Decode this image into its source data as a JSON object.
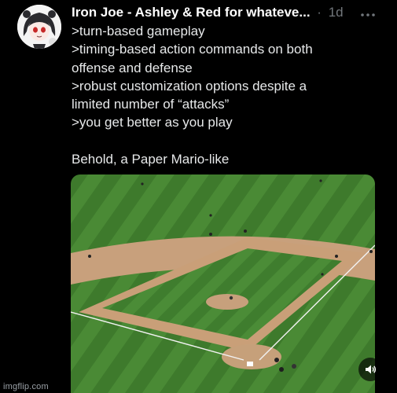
{
  "post": {
    "author_name": "Iron Joe - Ashley & Red for whateve...",
    "separator": "·",
    "timestamp": "1d",
    "text_lines": [
      ">turn-based gameplay",
      ">timing-based action commands on both",
      "offense and defense",
      ">robust customization options despite a",
      "limited number of “attacks”",
      ">you get better as you play",
      "",
      "Behold, a Paper Mario-like"
    ]
  },
  "icons": {
    "avatar": "anime-avatar",
    "more": "more-options-icon",
    "volume": "speaker-volume-icon"
  },
  "colors": {
    "background": "#000000",
    "text": "#e7e9ea",
    "muted": "#71767b",
    "grass": "#3f7a2e",
    "dirt": "#c9a07a"
  },
  "watermark": "imgflip.com"
}
